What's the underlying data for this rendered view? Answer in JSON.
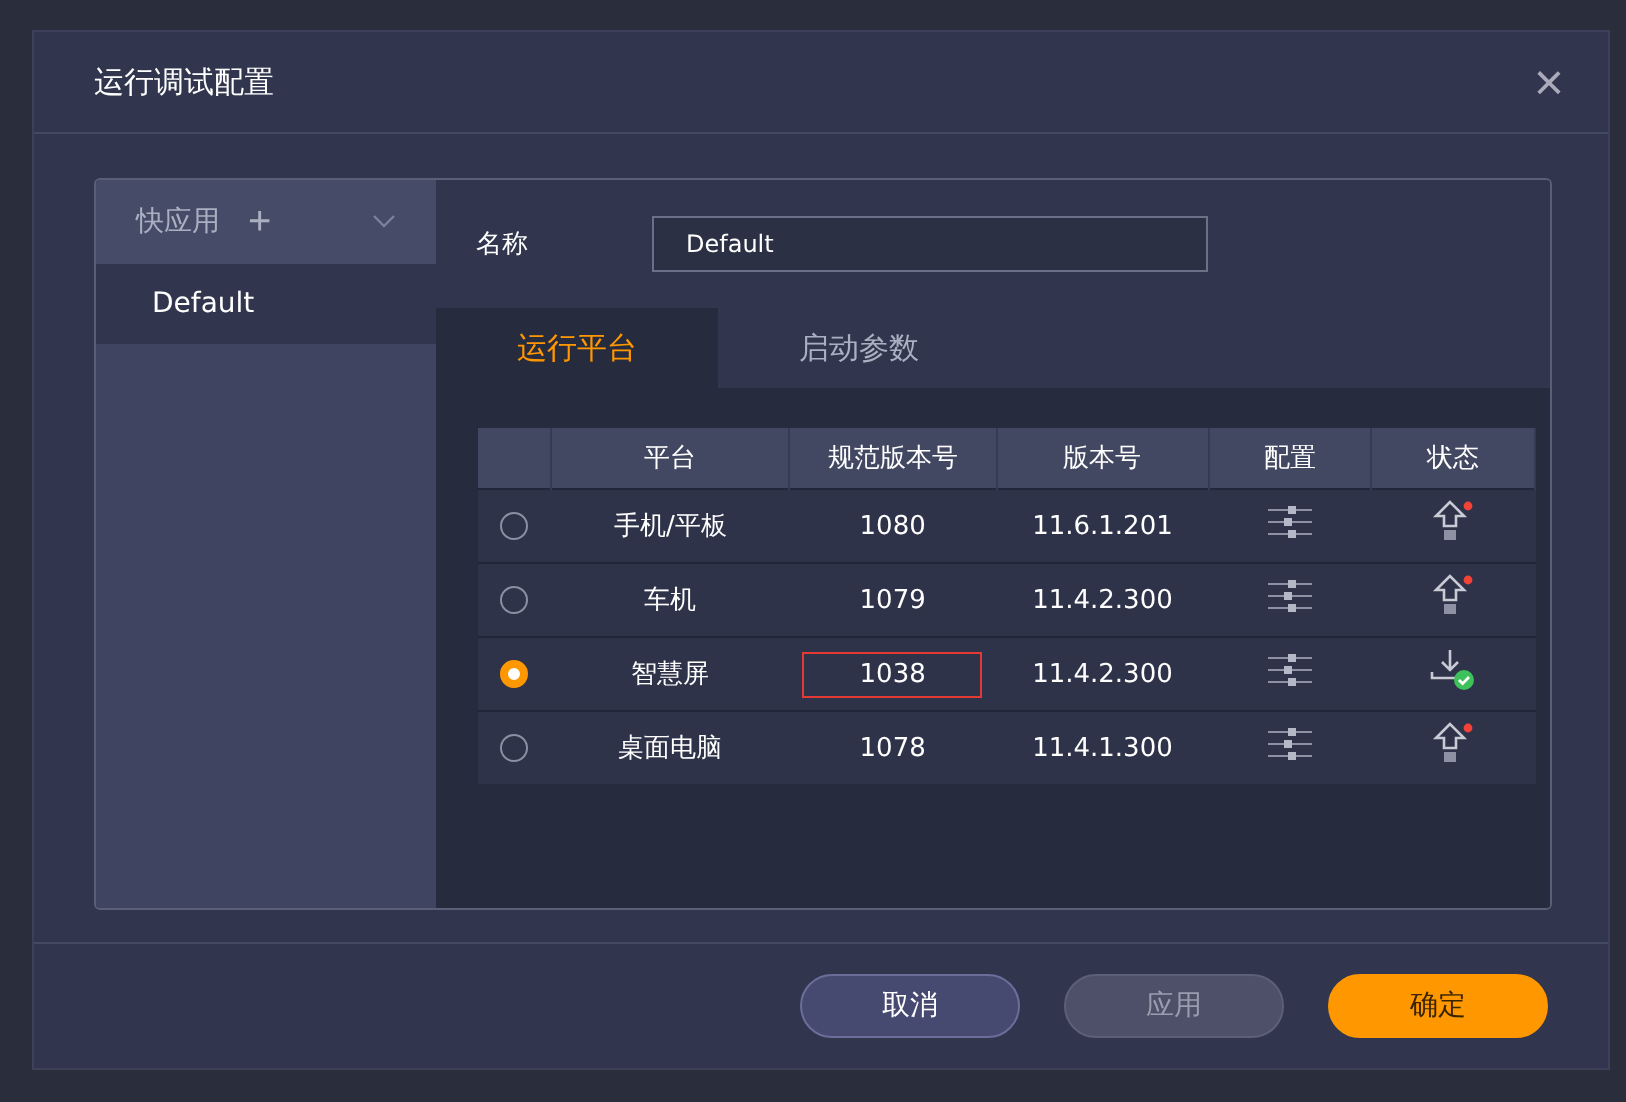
{
  "dialog": {
    "title": "运行调试配置",
    "close": "×"
  },
  "sidebar": {
    "header": {
      "label": "快应用",
      "add": "+"
    },
    "items": [
      {
        "label": "Default",
        "selected": true
      }
    ]
  },
  "name_field": {
    "label": "名称",
    "value": "Default"
  },
  "tabs": [
    {
      "label": "运行平台",
      "selected": true
    },
    {
      "label": "启动参数",
      "selected": false
    }
  ],
  "table": {
    "columns": [
      "平台",
      "规范版本号",
      "版本号",
      "配置",
      "状态"
    ],
    "rows": [
      {
        "selected": false,
        "platform": "手机/平板",
        "spec_version": "1080",
        "version": "11.6.1.201",
        "highlighted": false,
        "installed": false
      },
      {
        "selected": false,
        "platform": "车机",
        "spec_version": "1079",
        "version": "11.4.2.300",
        "highlighted": false,
        "installed": false
      },
      {
        "selected": true,
        "platform": "智慧屏",
        "spec_version": "1038",
        "version": "11.4.2.300",
        "highlighted": true,
        "installed": true
      },
      {
        "selected": false,
        "platform": "桌面电脑",
        "spec_version": "1078",
        "version": "11.4.1.300",
        "highlighted": false,
        "installed": false
      }
    ]
  },
  "buttons": [
    {
      "label": "取消",
      "kind": "secondary"
    },
    {
      "label": "应用",
      "kind": "disabled"
    },
    {
      "label": "确定",
      "kind": "primary"
    }
  ]
}
